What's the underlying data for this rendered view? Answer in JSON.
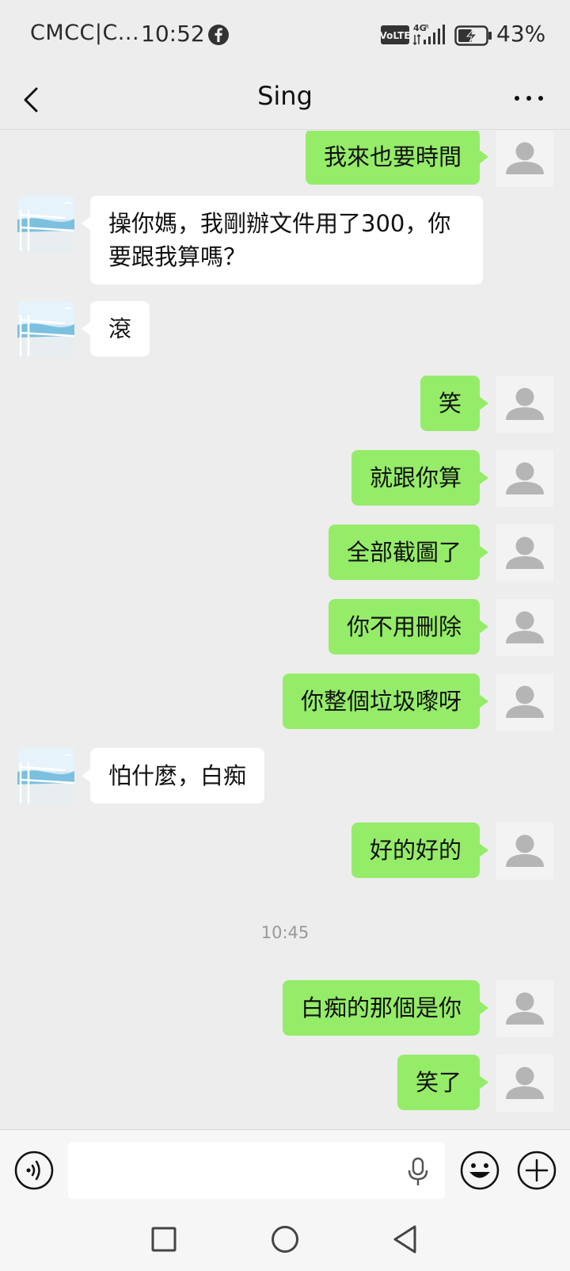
{
  "status_bar": {
    "carrier": "CMCC|C...",
    "time": "10:52",
    "battery": "43%",
    "icons": [
      "facebook-icon",
      "volte-icon",
      "signal-4g-icon",
      "battery-icon"
    ]
  },
  "header": {
    "title": "Sing",
    "back_icon": "chevron-left-icon",
    "more_icon": "ellipsis-icon"
  },
  "messages": [
    {
      "sender": "me",
      "text": "我來也要時間"
    },
    {
      "sender": "them",
      "text": "操你媽，我剛辦文件用了300，你要跟我算嗎？"
    },
    {
      "sender": "them",
      "text": "滾"
    },
    {
      "sender": "me",
      "text": "笑"
    },
    {
      "sender": "me",
      "text": "就跟你算"
    },
    {
      "sender": "me",
      "text": "全部截圖了"
    },
    {
      "sender": "me",
      "text": "你不用刪除"
    },
    {
      "sender": "me",
      "text": "你整個垃圾嚟呀"
    },
    {
      "sender": "them",
      "text": "怕什麼，白痴"
    },
    {
      "sender": "me",
      "text": "好的好的"
    },
    {
      "timestamp": "10:45"
    },
    {
      "sender": "me",
      "text": "白痴的那個是你"
    },
    {
      "sender": "me",
      "text": "笑了"
    }
  ],
  "input_bar": {
    "text": "",
    "icons": [
      "voice-icon",
      "mic-icon",
      "emoji-icon",
      "plus-icon"
    ]
  },
  "nav_bar": {
    "icons": [
      "recents-square-icon",
      "home-circle-icon",
      "back-triangle-icon"
    ]
  },
  "colors": {
    "background": "#ededed",
    "my_bubble": "#95ec69",
    "their_bubble": "#ffffff"
  }
}
